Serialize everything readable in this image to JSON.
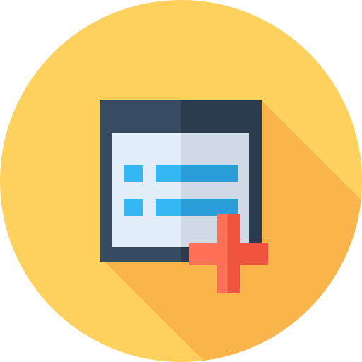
{
  "icon": {
    "name": "add-list-item-icon",
    "colors": {
      "circle_background": "#FED05E",
      "long_shadow": "#F9B44C",
      "window_frame_left": "#364B61",
      "window_frame_right": "#2C3B4D",
      "panel_left": "#E3EEFB",
      "panel_right": "#CFDAE6",
      "bullet_blue": "#36B8F5",
      "line_blue_dark": "#2A9ED8",
      "plus_left": "#FF7059",
      "plus_right": "#F0543E"
    },
    "list_rows": 2
  }
}
